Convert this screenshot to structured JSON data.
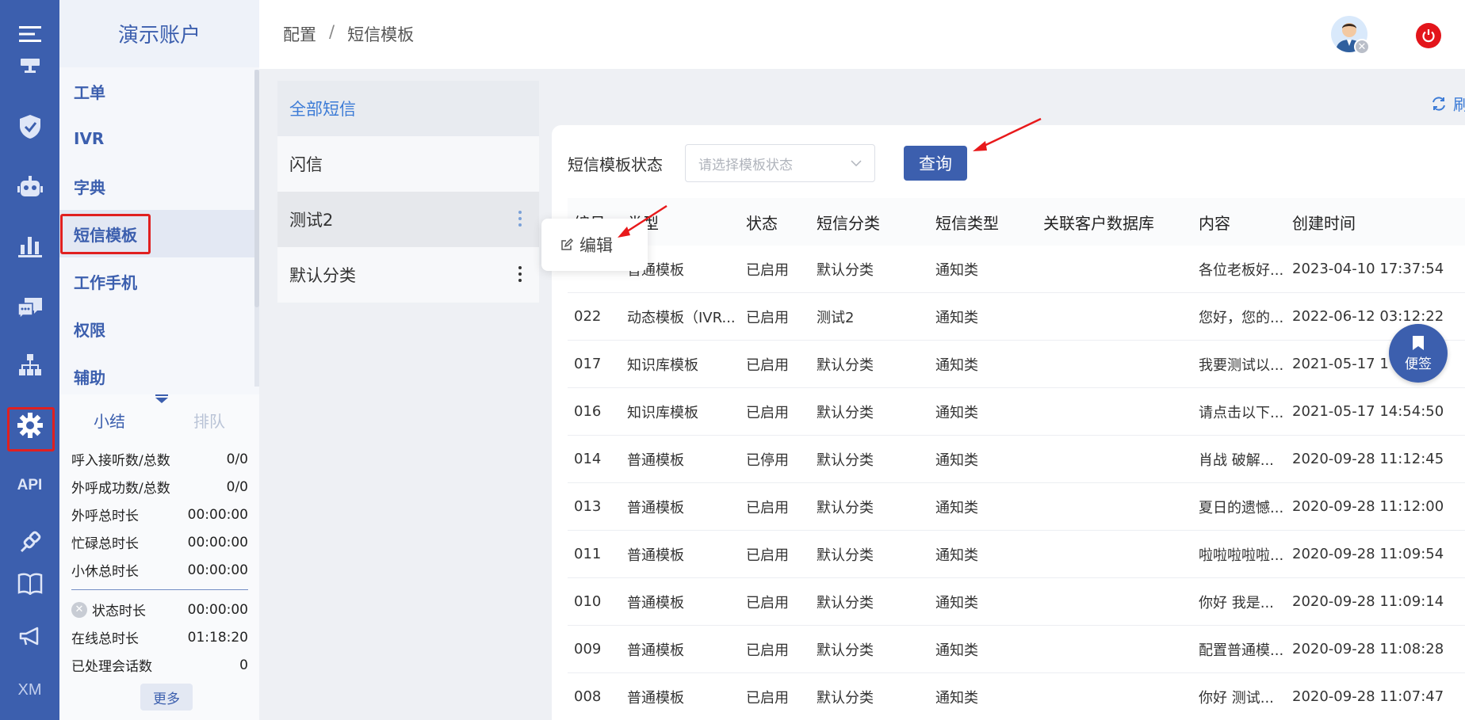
{
  "account": {
    "name": "演示账户"
  },
  "breadcrumb": {
    "root": "配置",
    "sep": "/",
    "current": "短信模板"
  },
  "rail": {
    "api_label": "API",
    "xm_label": "XM"
  },
  "nav": {
    "items": [
      {
        "label": "工单"
      },
      {
        "label": "IVR"
      },
      {
        "label": "字典"
      },
      {
        "label": "短信模板"
      },
      {
        "label": "工作手机"
      },
      {
        "label": "权限"
      },
      {
        "label": "辅助"
      }
    ]
  },
  "stats": {
    "tab_summary": "小结",
    "tab_queue": "排队",
    "rows": [
      {
        "label": "呼入接听数/总数",
        "value": "0/0"
      },
      {
        "label": "外呼成功数/总数",
        "value": "0/0"
      },
      {
        "label": "外呼总时长",
        "value": "00:00:00"
      },
      {
        "label": "忙碌总时长",
        "value": "00:00:00"
      },
      {
        "label": "小休总时长",
        "value": "00:00:00"
      }
    ],
    "rows2": [
      {
        "label": "状态时长",
        "value": "00:00:00"
      },
      {
        "label": "在线总时长",
        "value": "01:18:20"
      },
      {
        "label": "已处理会话数",
        "value": "0"
      }
    ],
    "more": "更多"
  },
  "categories": [
    {
      "label": "全部短信"
    },
    {
      "label": "闪信"
    },
    {
      "label": "测试2"
    },
    {
      "label": "默认分类"
    }
  ],
  "popup": {
    "edit": "编辑"
  },
  "refresh": "刷",
  "filter": {
    "label": "短信模板状态",
    "placeholder": "请选择模板状态",
    "query": "查询"
  },
  "table": {
    "headers": [
      "编号",
      "类型",
      "状态",
      "短信分类",
      "短信类型",
      "关联客户数据库",
      "内容",
      "创建时间"
    ],
    "rows": [
      [
        "",
        "普通模板",
        "已启用",
        "默认分类",
        "通知类",
        "",
        "各位老板好...",
        "2023-04-10 17:37:54"
      ],
      [
        "022",
        "动态模板（IVR...",
        "已启用",
        "测试2",
        "通知类",
        "",
        "您好，您的...",
        "2022-06-12 03:12:22"
      ],
      [
        "017",
        "知识库模板",
        "已启用",
        "默认分类",
        "通知类",
        "",
        "我要测试以...",
        "2021-05-17 1"
      ],
      [
        "016",
        "知识库模板",
        "已启用",
        "默认分类",
        "通知类",
        "",
        "请点击以下...",
        "2021-05-17 14:54:50"
      ],
      [
        "014",
        "普通模板",
        "已停用",
        "默认分类",
        "通知类",
        "",
        "肖战 破解...",
        "2020-09-28 11:12:45"
      ],
      [
        "013",
        "普通模板",
        "已启用",
        "默认分类",
        "通知类",
        "",
        "夏日的遗憾...",
        "2020-09-28 11:12:00"
      ],
      [
        "011",
        "普通模板",
        "已启用",
        "默认分类",
        "通知类",
        "",
        "啦啦啦啦啦...",
        "2020-09-28 11:09:54"
      ],
      [
        "010",
        "普通模板",
        "已启用",
        "默认分类",
        "通知类",
        "",
        "你好 我是...",
        "2020-09-28 11:09:14"
      ],
      [
        "009",
        "普通模板",
        "已启用",
        "默认分类",
        "通知类",
        "",
        "配置普通模...",
        "2020-09-28 11:08:28"
      ],
      [
        "008",
        "普通模板",
        "已启用",
        "默认分类",
        "通知类",
        "",
        "你好 测试...",
        "2020-09-28 11:07:47"
      ]
    ]
  },
  "note_fab": {
    "label": "便签"
  },
  "colors": {
    "brand": "#3c5fae",
    "highlight": "#e02020",
    "link": "#3c7bd6",
    "power": "#e3151b"
  }
}
